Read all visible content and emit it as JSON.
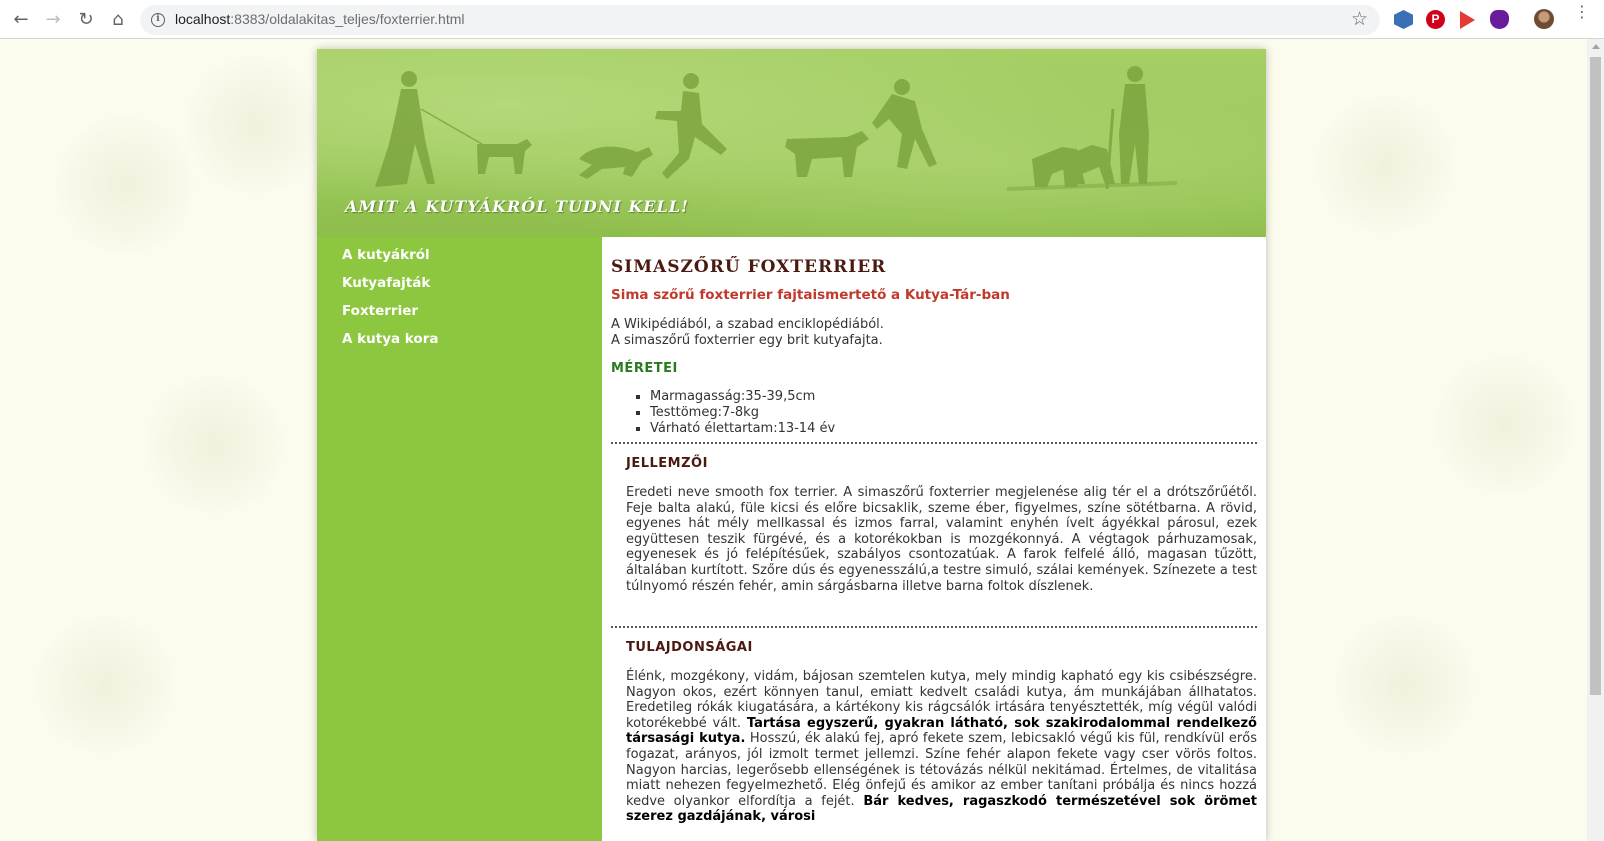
{
  "browser": {
    "url_host": "localhost",
    "url_rest": ":8383/oldalakitas_teljes/foxterrier.html"
  },
  "site": {
    "title": "Amit a kutyákról tudni kell!"
  },
  "sidebar": {
    "items": [
      {
        "label": "A kutyákról"
      },
      {
        "label": "Kutyafajták"
      },
      {
        "label": "Foxterrier"
      },
      {
        "label": "A kutya kora"
      }
    ]
  },
  "content": {
    "title": "SIMASZŐRŰ FOXTERRIER",
    "subtitle": "Sima szőrű foxterrier fajtaismertető a Kutya-Tár-ban",
    "intro_line1": "A Wikipédiából, a szabad enciklopédiából.",
    "intro_line2": "A simaszőrű foxterrier egy brit kutyafajta.",
    "sizes_heading": "MÉRETEI",
    "sizes": [
      "Marmagasság:35-39,5cm",
      "Testtömeg:7-8kg",
      "Várható élettartam:13-14 év"
    ],
    "section1_heading": "JELLEMZŐI",
    "section1_text": "Eredeti neve smooth fox terrier. A simaszőrű foxterrier megjelenése alig tér el a drótszőrűétől. Feje balta alakú, füle kicsi és előre bicsaklik, szeme éber, figyelmes, színe sötétbarna. A rövid, egyenes hát mély mellkassal és izmos farral, valamint enyhén ívelt ágyékkal párosul, ezek együttesen teszik fürgévé, és a kotorékokban is mozgékonnyá. A végtagok párhuzamosak, egyenesek és jó felépítésűek, szabályos csontozatúak. A farok felfelé álló, magasan tűzött, általában kurtított. Szőre dús és egyenesszálú,a testre simuló, szálai kemények. Színezete a test túlnyomó részén fehér, amin sárgásbarna illetve barna foltok díszlenek.",
    "section2_heading": "TULAJDONSÁGAI",
    "section2_text_a": "Élénk, mozgékony, vidám, bájosan szemtelen kutya, mely mindig kapható egy kis csibészségre. Nagyon okos, ezért könnyen tanul, emiatt kedvelt családi kutya, ám munkájában állhatatos. Eredetileg rókák kiugatására, a kártékony kis rágcsálók irtására tenyésztették, míg végül valódi kotorékebbé vált. ",
    "section2_text_bold1": "Tartása egyszerű, gyakran látható, sok szakirodalommal rendelkező társasági kutya.",
    "section2_text_b": " Hosszú, ék alakú fej, apró fekete szem, lebicsakló végű kis fül, rendkívül erős fogazat, arányos, jól izmolt termet jellemzi. Színe fehér alapon fekete vagy cser vörös foltos. Nagyon harcias, legerősebb ellenségének is tétovázás nélkül nekitámad. Értelmes, de vitalitása miatt nehezen fegyelmezhető. Elég önfejű és amikor az ember tanítani próbálja és nincs hozzá kedve olyankor elfordítja a fejét. ",
    "section2_text_bold2": "Bár kedves, ragaszkodó természetével sok örömet szerez gazdájának, városi"
  },
  "colors": {
    "sidebar_bg": "#8dc63f",
    "title_color": "#4a1a10",
    "subtitle_color": "#c0392b",
    "sizes_heading_color": "#2a7a1f"
  }
}
